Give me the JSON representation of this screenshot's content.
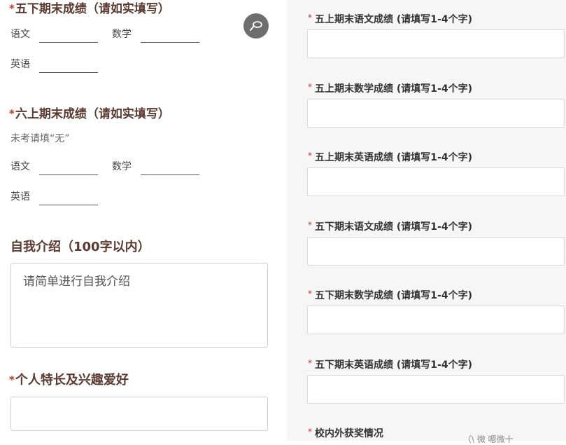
{
  "left": {
    "section1": {
      "star": "*",
      "title": "五下期末成绩（请如实填写）",
      "fields": [
        "语文",
        "数学",
        "英语"
      ]
    },
    "section2": {
      "star": "*",
      "title": "六上期末成绩（请如实填写）",
      "note": "未考请填“无”",
      "fields": [
        "语文",
        "数学",
        "英语"
      ]
    },
    "intro": {
      "title": "自我介绍（100字以内）",
      "placeholder": "请简单进行自我介绍"
    },
    "hobby": {
      "star": "*",
      "title": "个人特长及兴趣爱好"
    }
  },
  "right": {
    "questions": [
      {
        "star": "*",
        "label": "五上期末语文成绩 (请填写1-4个字)"
      },
      {
        "star": "*",
        "label": "五上期末数学成绩 (请填写1-4个字)"
      },
      {
        "star": "*",
        "label": "五上期末英语成绩 (请填写1-4个字)"
      },
      {
        "star": "*",
        "label": "五下期末语文成绩 (请填写1-4个字)"
      },
      {
        "star": "*",
        "label": "五下期末数学成绩 (请填写1-4个字)"
      },
      {
        "star": "*",
        "label": "五下期末英语成绩 (请填写1-4个字)"
      },
      {
        "star": "*",
        "label": "校内外获奖情况"
      }
    ],
    "watermark": "（\\ 微 嗯微十"
  },
  "icons": {
    "fab": "spoon-icon"
  },
  "colors": {
    "title": "#5b3a30",
    "required": "#c0392b",
    "fab": "#6e6e6e"
  }
}
